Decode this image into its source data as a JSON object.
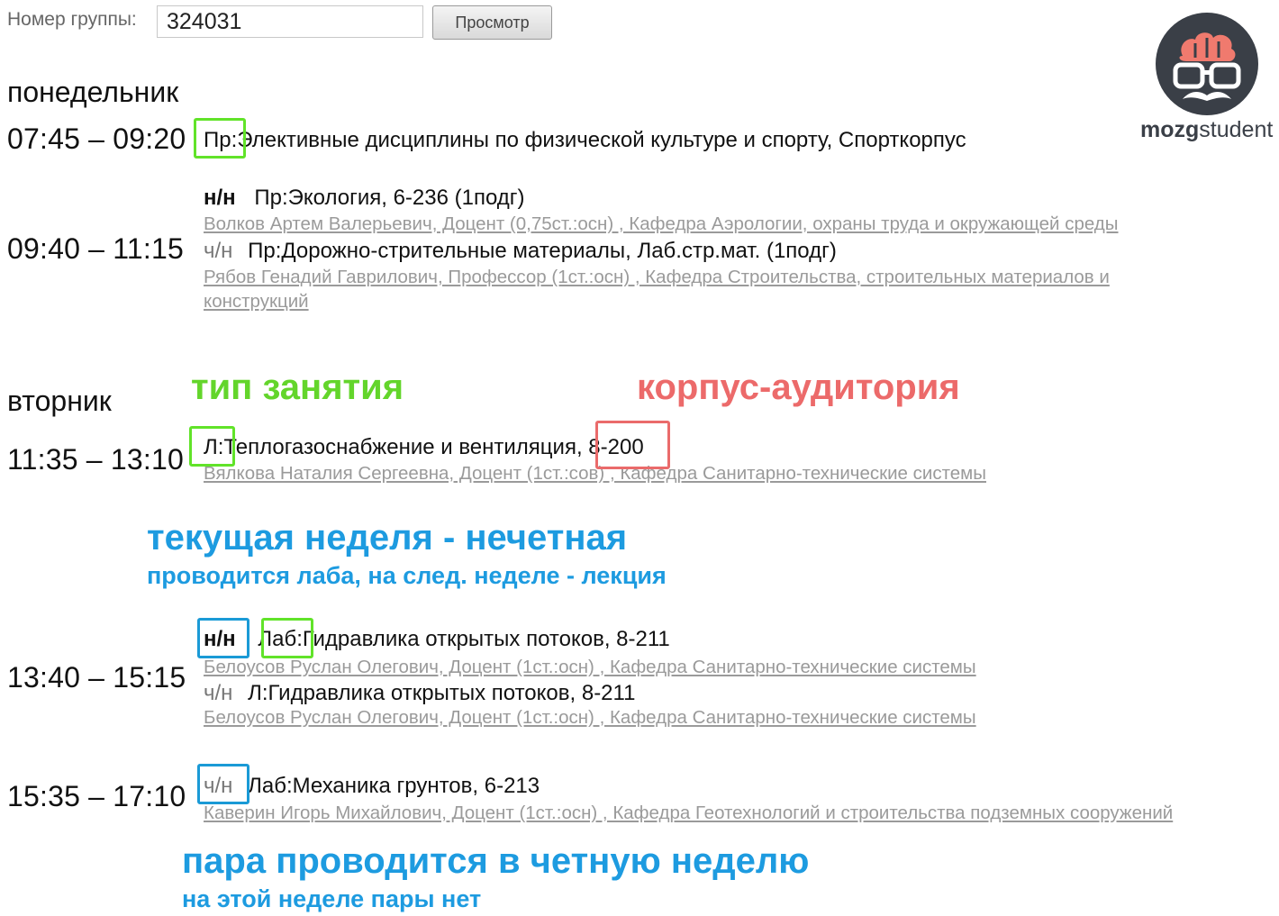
{
  "form": {
    "group_label": "Номер группы:",
    "group_value": "324031",
    "view_button": "Просмотр"
  },
  "logo": {
    "bold": "mozg",
    "regular": "student"
  },
  "monday": {
    "day": "понедельник",
    "slot1": {
      "time": "07:45 – 09:20",
      "text": "Пр:Элективные дисциплины по физической культуре и спорту, Спорткорпус"
    },
    "slot2": {
      "time": "09:40 – 11:15",
      "odd_week": "н/н",
      "odd_text": "Пр:Экология, 6-236 (1подг)",
      "odd_teacher": "Волков Артем Валерьевич, Доцент (0,75ст.:осн) ,  Кафедра Аэрологии, охраны труда и окружающей среды",
      "even_week": "ч/н",
      "even_text": "Пр:Дорожно-стрительные материалы, Лаб.стр.мат. (1подг)",
      "even_teacher_line1": "Рябов Генадий Гаврилович, Профессор (1ст.:осн) , Кафедра Строительства, строительных материалов и",
      "even_teacher_line2": "конструкций"
    }
  },
  "tuesday": {
    "day": "вторник",
    "slot1": {
      "time": "11:35 – 13:10",
      "text": "Л:Теплогазоснабжение и вентиляция, 8-200",
      "teacher": "Вялкова Наталия Сергеевна, Доцент (1ст.:сов) , Кафедра Санитарно-технические системы"
    },
    "slot2": {
      "time": "13:40 – 15:15",
      "odd_week": "н/н",
      "odd_text": "Лаб:Гидравлика открытых потоков, 8-211",
      "odd_teacher": "Белоусов Руслан Олегович, Доцент (1ст.:осн) , Кафедра Санитарно-технические системы",
      "even_week": "ч/н",
      "even_text": "Л:Гидравлика открытых потоков, 8-211",
      "even_teacher": "Белоусов Руслан Олегович, Доцент (1ст.:осн) , Кафедра Санитарно-технические системы"
    },
    "slot3": {
      "time": "15:35 – 17:10",
      "even_week": "ч/н",
      "even_text": "Лаб:Механика грунтов, 6-213",
      "even_teacher": "Каверин Игорь Михайлович, Доцент (1ст.:осн) , Кафедра Геотехнологий и строительства подземных сооружений"
    }
  },
  "annotations": {
    "type": "тип занятия",
    "building": "корпус-аудитория",
    "week_title": "текущая неделя - нечетная",
    "week_sub": "проводится лаба, на след. неделе - лекция",
    "even_title": "пара проводится в четную неделю",
    "even_sub": "на этой неделе пары нет"
  },
  "colors": {
    "green": "#61e329",
    "red": "#ea6b6b",
    "blue": "#1a9ad6",
    "logo_dark": "#3a3f47",
    "logo_brain": "#f07a6e"
  }
}
